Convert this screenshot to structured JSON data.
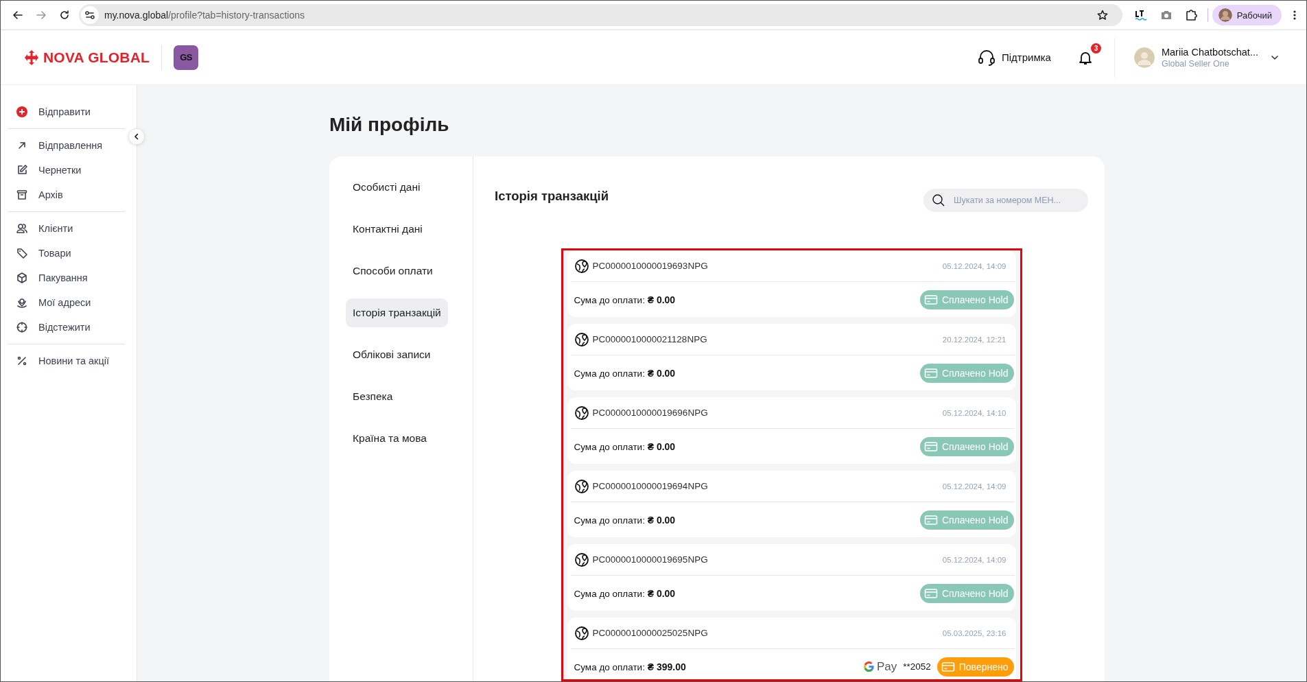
{
  "browser": {
    "url_host": "my.nova.global",
    "url_path": "/profile?tab=history-transactions",
    "profile_label": "Рабочий"
  },
  "header": {
    "logo": "NOVA GLOBAL",
    "app_badge": "GS",
    "support": "Підтримка",
    "notifications": "3",
    "user": {
      "name": "Mariia Chatbotschat...",
      "role": "Global Seller One"
    }
  },
  "sidebar": {
    "groups": [
      [
        {
          "label": "Відправити",
          "kind": "create"
        }
      ],
      [
        {
          "label": "Відправлення",
          "kind": "outgoing"
        },
        {
          "label": "Чернетки",
          "kind": "drafts"
        },
        {
          "label": "Архів",
          "kind": "archive"
        }
      ],
      [
        {
          "label": "Клієнти",
          "kind": "clients"
        },
        {
          "label": "Товари",
          "kind": "goods"
        },
        {
          "label": "Пакування",
          "kind": "packaging"
        },
        {
          "label": "Мої адреси",
          "kind": "addresses"
        },
        {
          "label": "Відстежити",
          "kind": "track"
        }
      ],
      [
        {
          "label": "Новини та акції",
          "kind": "news"
        }
      ]
    ]
  },
  "page": {
    "title": "Мій профіль"
  },
  "profile_tabs": [
    {
      "label": "Особисті дані",
      "selected": false
    },
    {
      "label": "Контактні дані",
      "selected": false
    },
    {
      "label": "Способи оплати",
      "selected": false
    },
    {
      "label": "Історія транзакцій",
      "selected": true
    },
    {
      "label": "Облікові записи",
      "selected": false
    },
    {
      "label": "Безпека",
      "selected": false
    },
    {
      "label": "Країна та мова",
      "selected": false
    }
  ],
  "section": {
    "title": "Історія транзакцій",
    "search": {
      "placeholder": "Шукати за номером МЕН..."
    }
  },
  "transactions": [
    {
      "number": "PC0000010000019693NPG",
      "date": "05.12.2024, 14:09",
      "amount": "Сума до оплати: **₴ 0.00**",
      "status": {
        "kind": "paid_hold",
        "label": "Сплачено Hold"
      }
    },
    {
      "number": "PC0000010000021128NPG",
      "date": "20.12.2024, 12:21",
      "amount": "Сума до оплати: **₴ 0.00**",
      "status": {
        "kind": "paid_hold",
        "label": "Сплачено Hold"
      }
    },
    {
      "number": "PC0000010000019696NPG",
      "date": "05.12.2024, 14:10",
      "amount": "Сума до оплати: **₴ 0.00**",
      "status": {
        "kind": "paid_hold",
        "label": "Сплачено Hold"
      }
    },
    {
      "number": "PC0000010000019694NPG",
      "date": "05.12.2024, 14:09",
      "amount": "Сума до оплати: **₴ 0.00**",
      "status": {
        "kind": "paid_hold",
        "label": "Сплачено Hold"
      }
    },
    {
      "number": "PC0000010000019695NPG",
      "date": "05.12.2024, 14:09",
      "amount": "Сума до оплати: **₴ 0.00**",
      "status": {
        "kind": "paid_hold",
        "label": "Сплачено Hold"
      }
    },
    {
      "number": "PC0000010000025025NPG",
      "date": "05.03.2025, 23:16",
      "amount": "Сума до оплати: **₴ 399.00**",
      "payment": {
        "wallet": "Pay",
        "card": "**2052"
      },
      "status": {
        "kind": "refunded",
        "label": "Повернено"
      }
    }
  ]
}
